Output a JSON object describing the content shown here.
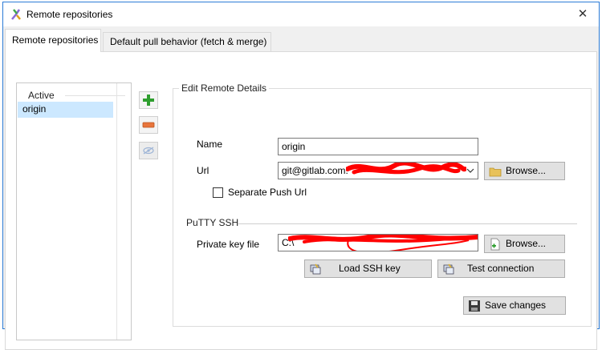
{
  "window": {
    "title": "Remote repositories",
    "close_glyph": "✕",
    "icon": "git-extensions-logo-icon"
  },
  "tabs": [
    {
      "label": "Remote repositories",
      "selected": true
    },
    {
      "label": "Default pull behavior (fetch & merge)",
      "selected": false
    }
  ],
  "remote_list": {
    "header": "Active",
    "items": [
      {
        "label": "origin",
        "selected": true
      }
    ]
  },
  "side_buttons": {
    "add_icon": "plus-icon",
    "remove_icon": "minus-icon",
    "toggle_icon": "eye-hidden-icon"
  },
  "edit": {
    "group_title": "Edit Remote Details",
    "name_label": "Name",
    "name_value": "origin",
    "url_label": "Url",
    "url_value": "git@gitlab.com:",
    "url_redacted": true,
    "browse_label": "Browse...",
    "separate_push_label": "Separate Push Url",
    "separate_push_checked": false,
    "putty_title": "PuTTY SSH",
    "private_key_label": "Private key file",
    "private_key_value": "C:\\",
    "private_key_redacted": true,
    "key_browse_label": "Browse...",
    "load_ssh_label": "Load SSH key",
    "test_connection_label": "Test connection",
    "save_label": "Save changes"
  },
  "colors": {
    "accent_border": "#2b7bd6",
    "selection": "#cce8ff",
    "redaction": "#ff0000",
    "add_green": "#2e9e2e",
    "remove_orange": "#e8743b"
  }
}
